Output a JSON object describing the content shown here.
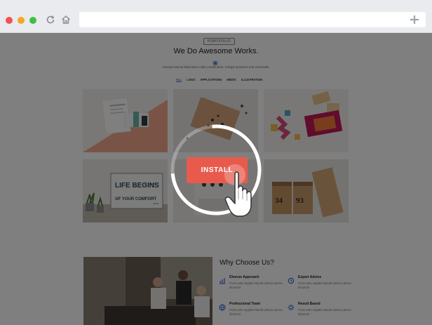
{
  "browser": {
    "icons": [
      "reload-icon",
      "home-icon",
      "plus-icon"
    ],
    "window_dots": [
      "#ef5350",
      "#f5a623",
      "#3ec048"
    ]
  },
  "portfolio": {
    "badge": "PORTFOLIO",
    "title": "We Do Awesome Works.",
    "subtitle": "Aenean lacinia bibendum nulla consectetur. Integer posuere erat venenatis.",
    "filters": [
      "ALL",
      "LOGO",
      "APPLICATIONS",
      "MEDIC",
      "ILLUSTRATION"
    ],
    "active_filter": "ALL"
  },
  "tiles": {
    "tile4_line1": "LIFE BEGINS",
    "tile4_line1b": "AT THE END",
    "tile4_line2": "OF YOUR COMFORT",
    "tile4_line2b": "ZONE",
    "box_left_number": "34",
    "box_right_number": "93"
  },
  "install": {
    "label": "INSTALL",
    "accent": "#e85b4c"
  },
  "why": {
    "title": "Why Choose Us?",
    "features": [
      {
        "title": "Diverse Approach",
        "text": "Proin ante sagittis blandit ultricies plena dictumst"
      },
      {
        "title": "Expert Advice",
        "text": "Proin ante sagittis blandit ultricies plena dictumst"
      },
      {
        "title": "Professional Team",
        "text": "Proin ante sagittis blandit ultricies plena dictumst"
      },
      {
        "title": "Result Based",
        "text": "Proin ante sagittis blandit ultricies plena dictumst"
      }
    ]
  }
}
